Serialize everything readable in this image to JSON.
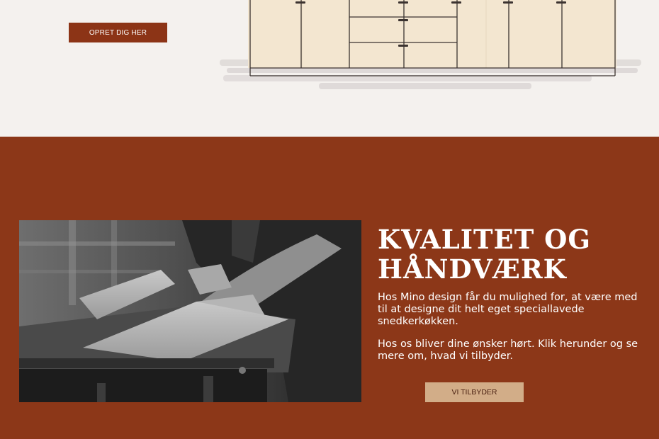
{
  "hero": {
    "signup_button": "OPRET DIG HER"
  },
  "feature": {
    "heading_line1": "KVALITET OG",
    "heading_line2": "HÅNDVÆRK",
    "paragraph1": "Hos Mino design får du mulighed for, at være med til at designe dit helt eget speciallavede snedkerkøkken.",
    "paragraph2": "Hos os bliver dine ønsker hørt. Klik herunder og se mere om, hvad vi tilbyder.",
    "offers_button": "VI TILBYDER"
  },
  "colors": {
    "page_background": "#f4f1ee",
    "brand_rust": "#8c3718",
    "button_dark": "#8c3416",
    "button_light": "#d2ad88"
  }
}
